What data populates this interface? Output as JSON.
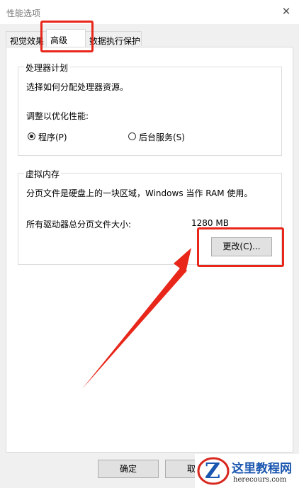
{
  "window": {
    "title": "性能选项",
    "close_glyph": "✕"
  },
  "tabs": [
    {
      "label": "视觉效果",
      "active": false
    },
    {
      "label": "高级",
      "active": true
    },
    {
      "label": "数据执行保护",
      "active": false
    }
  ],
  "processor": {
    "title": "处理器计划",
    "description": "选择如何分配处理器资源。",
    "optimize_label": "调整以优化性能:",
    "option_programs": "程序(P)",
    "option_services": "后台服务(S)"
  },
  "virtual_memory": {
    "title": "虚拟内存",
    "description": "分页文件是硬盘上的一块区域，Windows 当作 RAM 使用。",
    "total_label": "所有驱动器总分页文件大小:",
    "total_value": "1280 MB",
    "change_button": "更改(C)..."
  },
  "footer": {
    "ok": "确定",
    "cancel": "取"
  },
  "watermark": {
    "brand": "这里教程网",
    "url": "herecours.com"
  },
  "colors": {
    "annotation": "#e8261a",
    "logo_blue": "#1a56b0"
  }
}
